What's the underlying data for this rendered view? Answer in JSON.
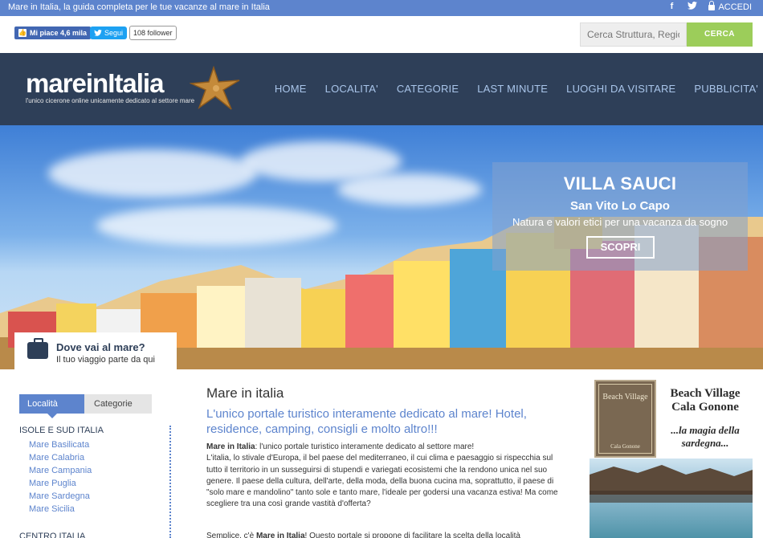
{
  "topbar": {
    "tagline": "Mare in Italia, la guida completa per le tue vacanze al mare in Italia",
    "login_label": "ACCEDI"
  },
  "widgets": {
    "fb_like_label": "Mi piace 4,6 mila",
    "tw_follow_label": "Segui",
    "tw_followers": "108 follower"
  },
  "search": {
    "placeholder": "Cerca Struttura, Regione...",
    "button_label": "CERCA"
  },
  "header": {
    "logo_text": "mareinItalia",
    "logo_subtitle": "l'unico cicerone online unicamente dedicato al settore mare",
    "nav": [
      "HOME",
      "LOCALITA'",
      "CATEGORIE",
      "LAST MINUTE",
      "LUOGHI DA VISITARE",
      "PUBBLICITA'"
    ]
  },
  "hero": {
    "title": "VILLA SAUCI",
    "location": "San Vito Lo Capo",
    "description": "Natura e valori etici per una vacanza da sogno",
    "button_label": "SCOPRI",
    "dove_title": "Dove vai al mare?",
    "dove_subtitle": "Il tuo viaggio parte da qui"
  },
  "sidebar": {
    "tabs": [
      "Località",
      "Categorie"
    ],
    "region1": "ISOLE E SUD ITALIA",
    "links": [
      "Mare Basilicata",
      "Mare Calabria",
      "Mare Campania",
      "Mare Puglia",
      "Mare Sardegna",
      "Mare Sicilia"
    ],
    "region2": "CENTRO ITALIA"
  },
  "main": {
    "title": "Mare in italia",
    "subtitle": "L'unico portale turistico interamente dedicato al mare! Hotel, residence, camping, consigli e molto altro!!!",
    "p1_bold": "Mare in Italia",
    "p1_text": ": l'unico portale turistico interamente dedicato al settore mare!",
    "p2": "L'italia, lo stivale d'Europa, il bel paese del mediterraneo, il cui clima e paesaggio si rispecchia sul tutto il territorio in un susseguirsi di stupendi e variegati ecosistemi che la rendono unica nel suo genere. Il paese della cultura, dell'arte, della moda, della buona cucina ma, soprattutto, il paese di \"solo mare e mandolino\" tanto sole e tanto mare, l'ideale per godersi una vacanza estiva! Ma come scegliere tra una così grande vastità d'offerta?",
    "p3_a": "Semplice, c'è ",
    "p3_bold": "Mare in Italia",
    "p3_b": "! Questo portale si propone di facilitare la scelta della località"
  },
  "ad": {
    "sign_title": "Beach Village",
    "sign_sub": "Cala Gonone",
    "title": "Beach Village Cala Gonone",
    "slogan": "...la magia della sardegna..."
  }
}
